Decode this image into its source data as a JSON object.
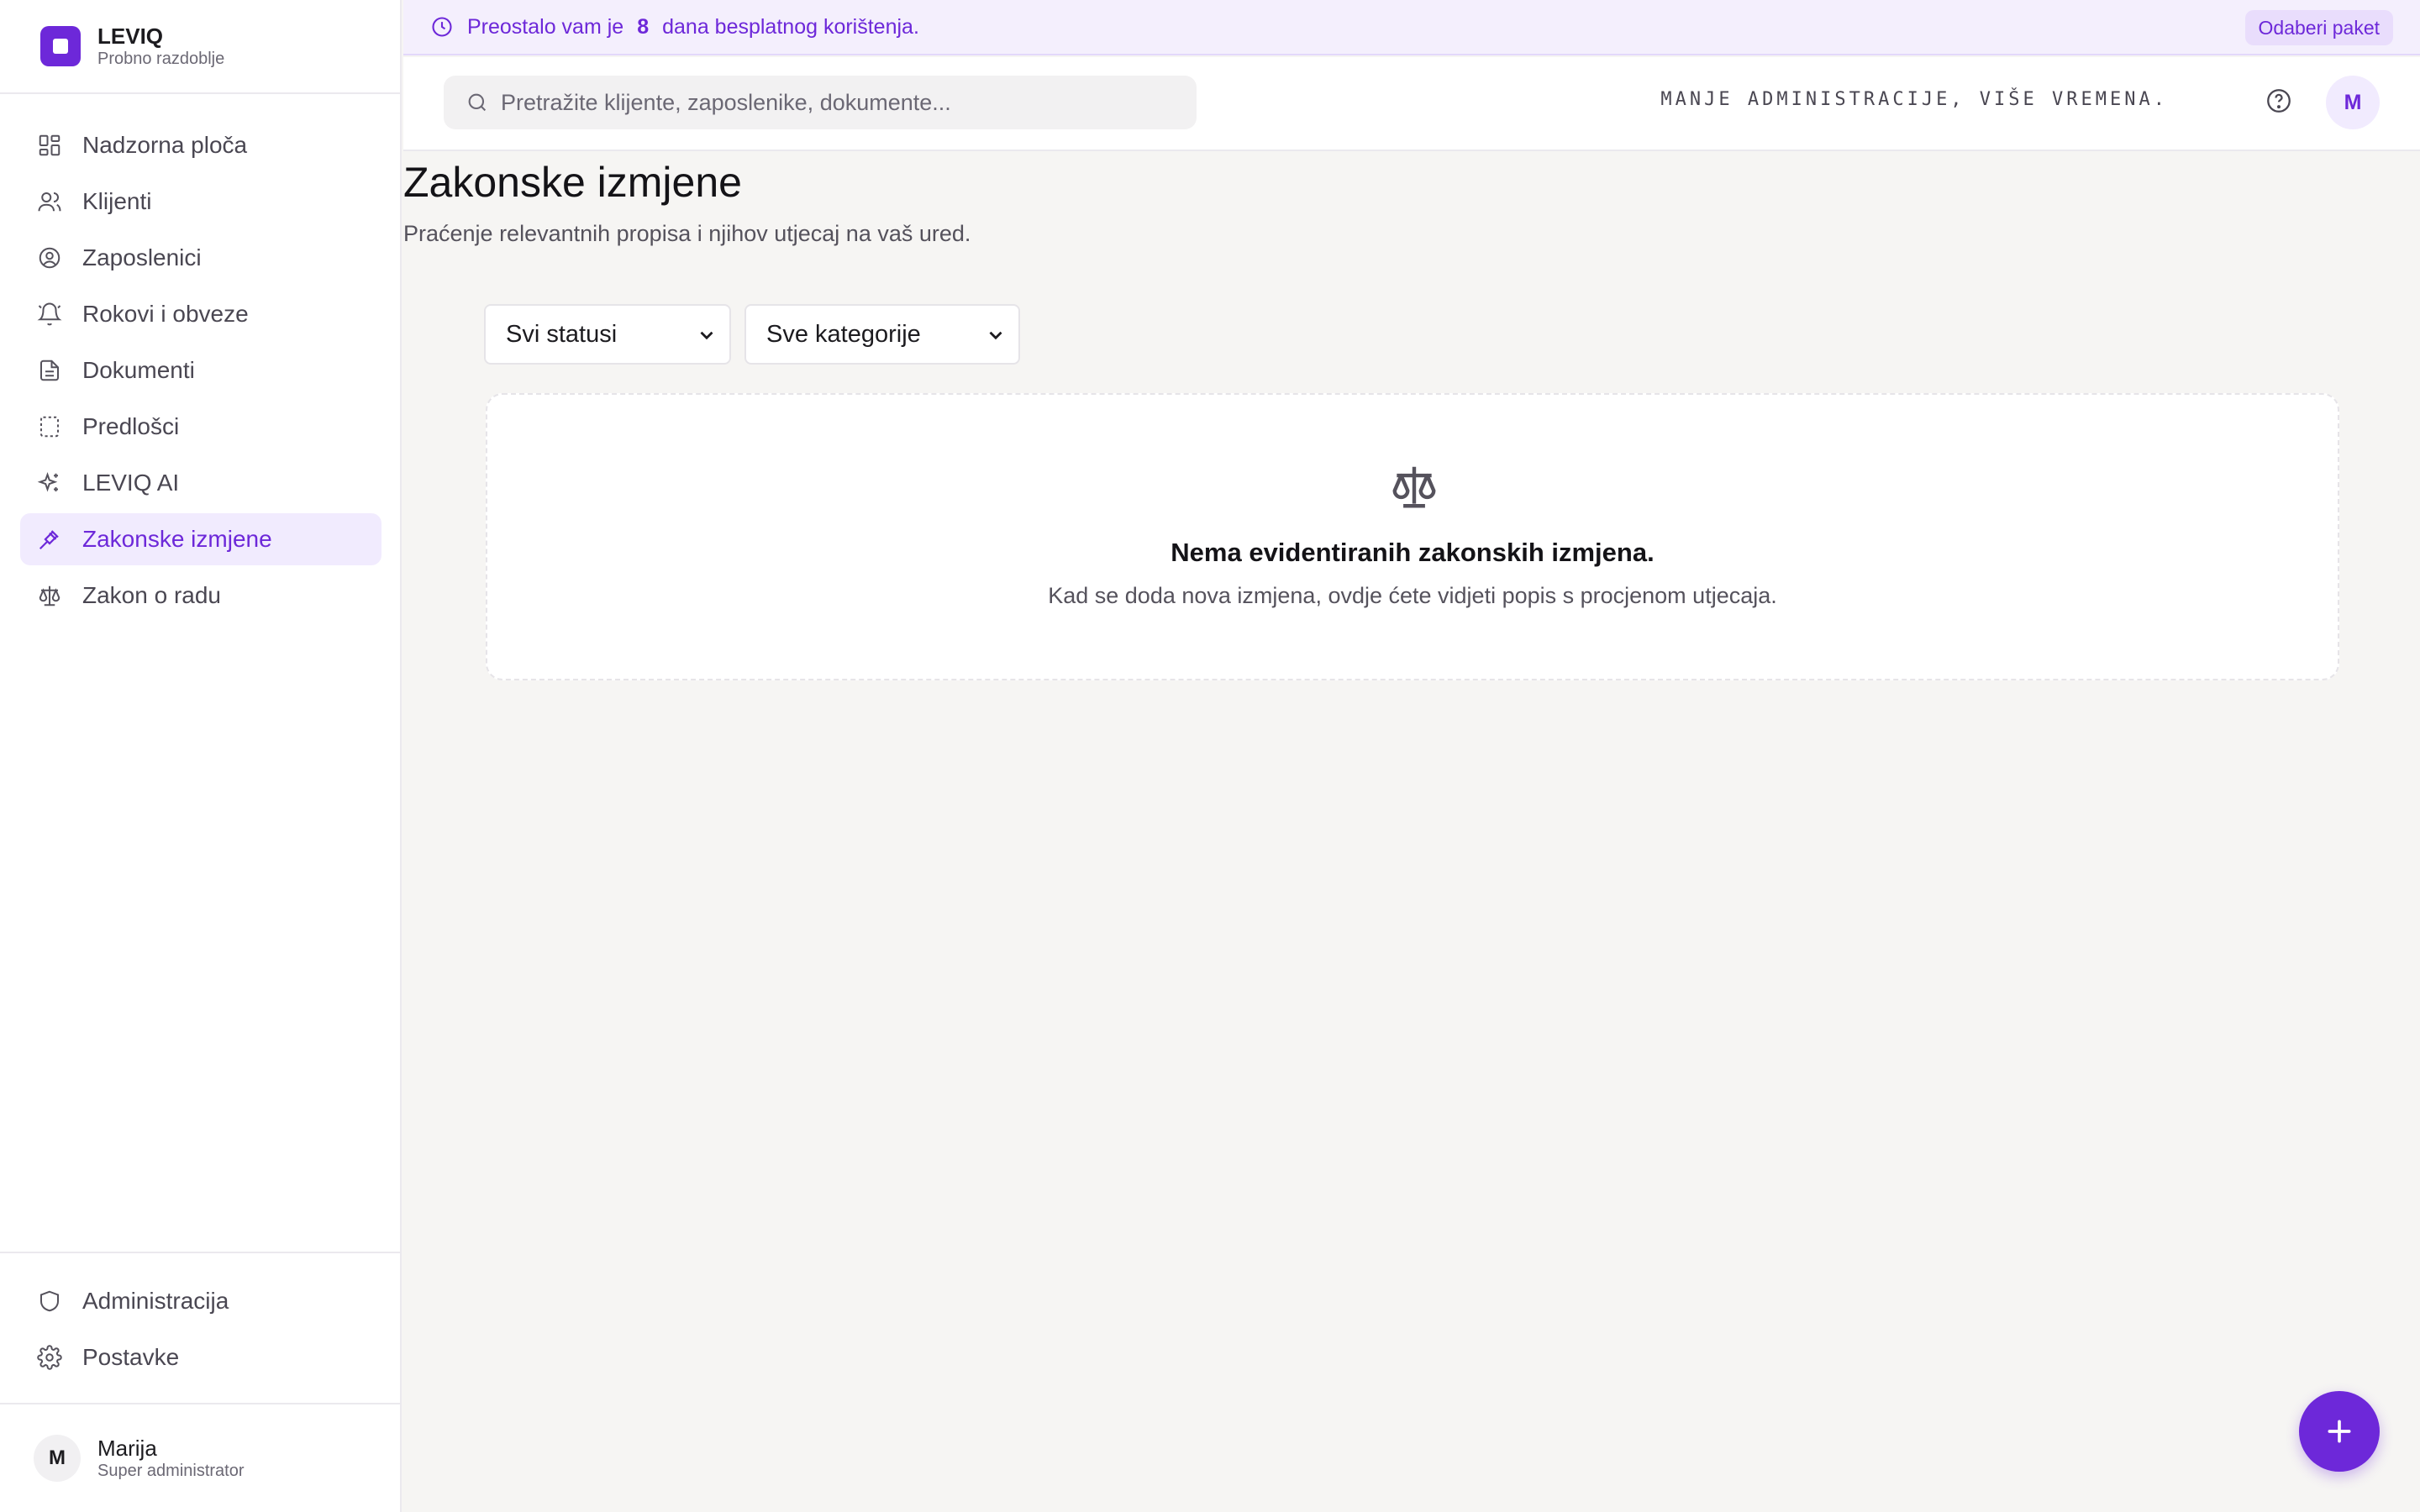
{
  "brand": {
    "name": "LEVIQ",
    "subtitle": "Probno razdoblje"
  },
  "sidebar": {
    "items": [
      {
        "label": "Nadzorna ploča",
        "icon": "dashboard-icon"
      },
      {
        "label": "Klijenti",
        "icon": "users-icon"
      },
      {
        "label": "Zaposlenici",
        "icon": "user-circle-icon"
      },
      {
        "label": "Rokovi i obveze",
        "icon": "bell-icon"
      },
      {
        "label": "Dokumenti",
        "icon": "document-icon"
      },
      {
        "label": "Predlošci",
        "icon": "template-icon"
      },
      {
        "label": "LEVIQ AI",
        "icon": "sparkles-icon"
      },
      {
        "label": "Zakonske izmjene",
        "icon": "gavel-icon",
        "active": true
      },
      {
        "label": "Zakon o radu",
        "icon": "scale-icon"
      }
    ],
    "bottom_items": [
      {
        "label": "Administracija",
        "icon": "shield-icon"
      },
      {
        "label": "Postavke",
        "icon": "gear-icon"
      }
    ]
  },
  "user": {
    "initial": "M",
    "name": "Marija",
    "role": "Super administrator"
  },
  "banner": {
    "prefix": "Preostalo vam je",
    "days": "8",
    "suffix": "dana besplatnog korištenja.",
    "button_label": "Odaberi paket"
  },
  "topbar": {
    "search_placeholder": "Pretražite klijente, zaposlenike, dokumente...",
    "tagline": "MANJE ADMINISTRACIJE, VIŠE VREMENA.",
    "avatar_initial": "M"
  },
  "page": {
    "title": "Zakonske izmjene",
    "subtitle": "Praćenje relevantnih propisa i njihov utjecaj na vaš ured."
  },
  "filters": {
    "status_selected": "Svi statusi",
    "category_selected": "Sve kategorije"
  },
  "empty_state": {
    "icon": "scale-icon",
    "title": "Nema evidentiranih zakonskih izmjena.",
    "text": "Kad se doda nova izmjena, ovdje ćete vidjeti popis s procjenom utjecaja."
  },
  "colors": {
    "accent": "#6d28d9",
    "accent_light": "#f1ebfe",
    "background": "#f6f5f3"
  }
}
